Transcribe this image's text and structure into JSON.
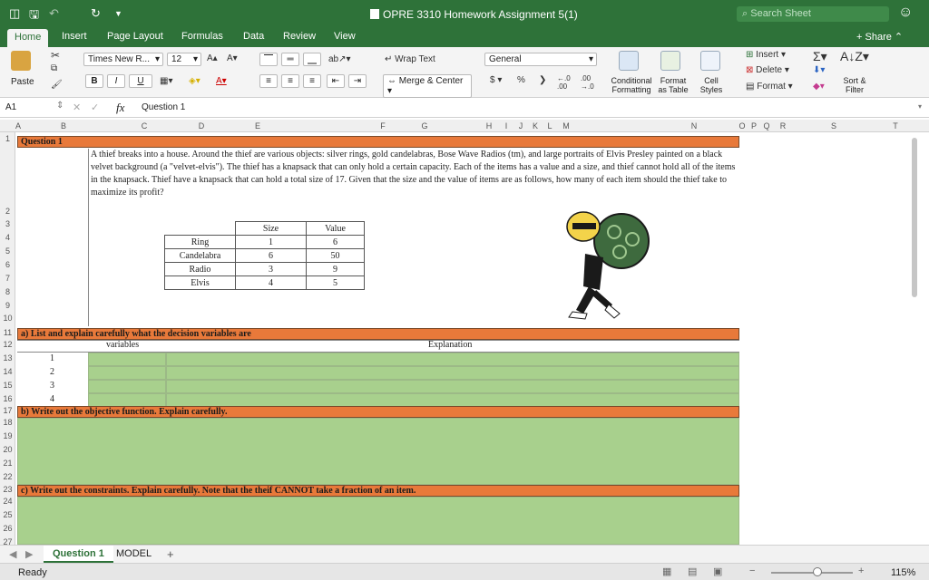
{
  "titlebar": {
    "doc_title": "OPRE 3310 Homework Assignment 5(1)",
    "search_placeholder": "Search Sheet"
  },
  "ribbon_tabs": [
    "Home",
    "Insert",
    "Page Layout",
    "Formulas",
    "Data",
    "Review",
    "View"
  ],
  "share_label": "Share",
  "ribbon": {
    "paste": "Paste",
    "font_name": "Times New R...",
    "font_size": "12",
    "wrap_text": "Wrap Text",
    "merge_center": "Merge & Center",
    "number_format": "General",
    "currency": "$",
    "percent": "%",
    "conditional_formatting": "Conditional Formatting",
    "format_as_table": "Format as Table",
    "cell_styles": "Cell Styles",
    "insert": "Insert",
    "delete": "Delete",
    "format": "Format",
    "sort_filter": "Sort & Filter"
  },
  "formula_bar": {
    "name_box": "A1",
    "fx": "fx",
    "content": "Question 1"
  },
  "columns": [
    "A",
    "B",
    "C",
    "D",
    "E",
    "F",
    "G",
    "H",
    "I",
    "J",
    "K",
    "L",
    "M",
    "N",
    "O",
    "P",
    "Q",
    "R",
    "S",
    "T"
  ],
  "rows": [
    "1",
    "2",
    "3",
    "4",
    "5",
    "6",
    "7",
    "8",
    "9",
    "10",
    "11",
    "12",
    "13",
    "14",
    "15",
    "16",
    "17",
    "18",
    "19",
    "20",
    "21",
    "22",
    "23",
    "24",
    "25",
    "26",
    "27"
  ],
  "sheet": {
    "question_title": "Question 1",
    "question_text": "A thief breaks into a house. Around the thief are various objects: silver rings, gold candelabras, Bose Wave Radios (tm), and large portraits of Elvis Presley painted on a black velvet background (a \"velvet-elvis\"). The thief has a knapsack that can only hold a certain capacity. Each of the items has a value and a size, and thief cannot hold all of the items in the knapsack. Thief have a knapsack that can hold a total size of 17. Given that the size and the value of items are as follows, how many of each item should the thief take to maximize its profit?",
    "table_headers": [
      "Size",
      "Value"
    ],
    "items": [
      {
        "name": "Ring",
        "size": "1",
        "value": "6"
      },
      {
        "name": "Candelabra",
        "size": "6",
        "value": "50"
      },
      {
        "name": "Radio",
        "size": "3",
        "value": "9"
      },
      {
        "name": "Elvis",
        "size": "4",
        "value": "5"
      }
    ],
    "part_a": "a) List and explain carefully what the decision variables are",
    "col_variables": "variables",
    "col_explanation": "Explanation",
    "var_numbers": [
      "1",
      "2",
      "3",
      "4"
    ],
    "part_b": "b) Write out the objective function. Explain carefully.",
    "part_c": "c) Write out the constraints. Explain carefully. Note that the theif CANNOT take a fraction of an item."
  },
  "sheet_tabs": [
    "Question 1",
    "MODEL"
  ],
  "status": {
    "ready": "Ready",
    "zoom": "115%"
  },
  "colors": {
    "excel_green": "#2e7239",
    "orange": "#e8793a",
    "cell_green": "#a8d08d"
  }
}
